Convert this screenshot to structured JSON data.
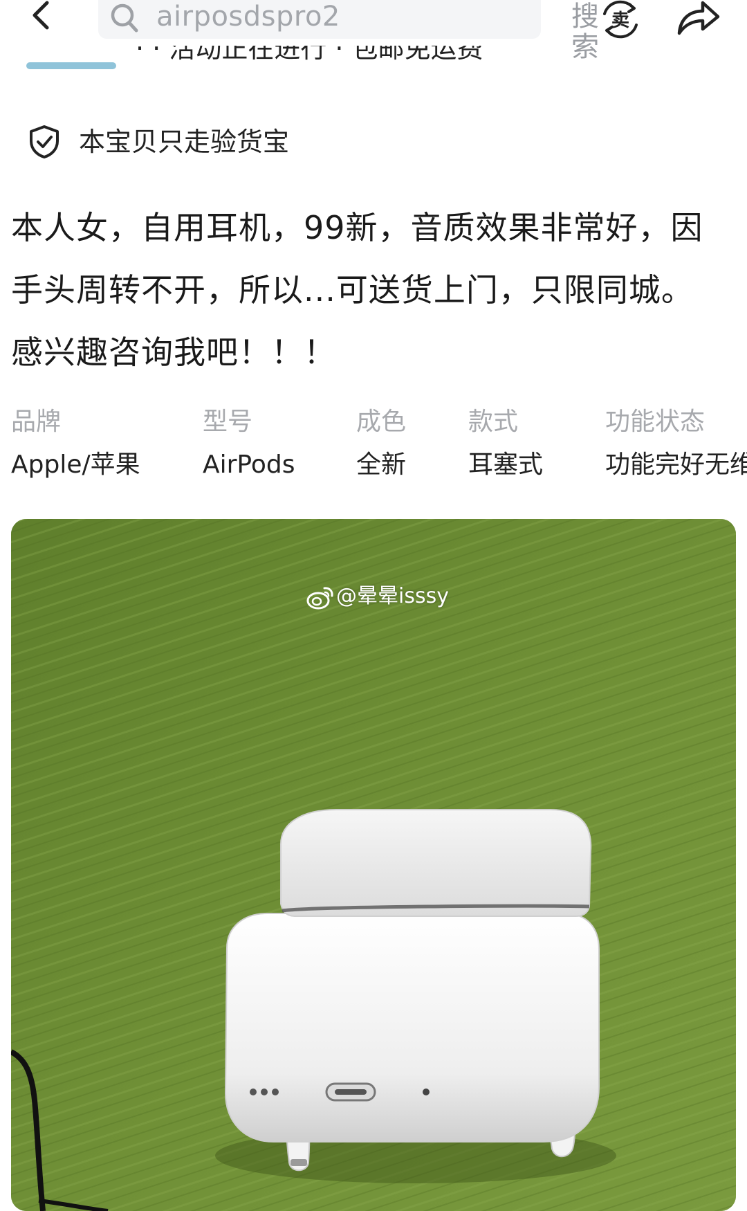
{
  "search": {
    "value": "airposdspro2",
    "button_label": "搜索"
  },
  "header_icons": {
    "back": "chevron-left-icon",
    "search": "magnifier-icon",
    "sell": "卖",
    "share": "share-arrow-icon"
  },
  "cutoff_line": {
    "text": "· · 活动正在进行 · 包邮免运费"
  },
  "guarantee": {
    "text": "本宝贝只走验货宝",
    "icon": "shield-check-icon"
  },
  "description": {
    "lines": [
      "本人女，自用耳机，99新，音质效果非常好，因",
      "手头周转不开，所以...可送货上门，只限同城。",
      "感兴趣咨询我吧！！！"
    ]
  },
  "attributes": [
    {
      "label": "品牌",
      "value": "Apple/苹果"
    },
    {
      "label": "型号",
      "value": "AirPods"
    },
    {
      "label": "成色",
      "value": "全新"
    },
    {
      "label": "款式",
      "value": "耳塞式"
    },
    {
      "label": "功能状态",
      "value": "功能完好无维修"
    }
  ],
  "photo": {
    "watermark": "@晕晕isssy",
    "watermark_logo": "weibo-logo-icon"
  },
  "colors": {
    "background": "#ffffff",
    "search_box": "#f4f5f7",
    "muted_text": "#a7a9ad",
    "photo_green": "#6a8a34",
    "accent_tag": "#8fc3d9"
  }
}
